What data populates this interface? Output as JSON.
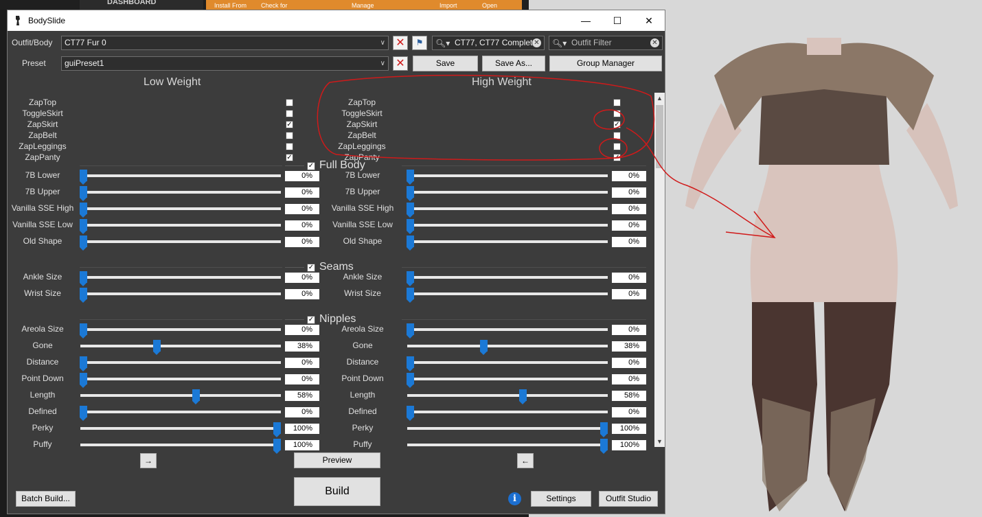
{
  "background_app": {
    "dashboard_label": "DASHBOARD",
    "toolbar_items": [
      "Install From",
      "Check for",
      "Manage",
      "Import",
      "Open"
    ]
  },
  "window": {
    "title": "BodySlide",
    "controls": {
      "minimize": "—",
      "maximize": "☐",
      "close": "✕"
    }
  },
  "top": {
    "outfit_label": "Outfit/Body",
    "outfit_value": "CT77 Fur 0",
    "preset_label": "Preset",
    "preset_value": "guiPreset1",
    "group_filter": "CT77, CT77 Complet",
    "outfit_filter_placeholder": "Outfit Filter",
    "save": "Save",
    "save_as": "Save As...",
    "group_manager": "Group Manager"
  },
  "columns": {
    "low": "Low Weight",
    "high": "High Weight"
  },
  "zaps": [
    {
      "label": "ZapTop",
      "low": false,
      "high": false
    },
    {
      "label": "ToggleSkirt",
      "low": false,
      "high": false
    },
    {
      "label": "ZapSkirt",
      "low": true,
      "high": true
    },
    {
      "label": "ZapBelt",
      "low": false,
      "high": false
    },
    {
      "label": "ZapLeggings",
      "low": false,
      "high": false
    },
    {
      "label": "ZapPanty",
      "low": true,
      "high": true
    }
  ],
  "sections": [
    {
      "title": "Full Body",
      "checked": true,
      "sliders": [
        {
          "label": "7B Lower",
          "low": 0,
          "high": 0
        },
        {
          "label": "7B Upper",
          "low": 0,
          "high": 0
        },
        {
          "label": "Vanilla SSE High",
          "low": 0,
          "high": 0
        },
        {
          "label": "Vanilla SSE Low",
          "low": 0,
          "high": 0
        },
        {
          "label": "Old Shape",
          "low": 0,
          "high": 0
        }
      ]
    },
    {
      "title": "Seams",
      "checked": true,
      "sliders": [
        {
          "label": "Ankle Size",
          "low": 0,
          "high": 0
        },
        {
          "label": "Wrist Size",
          "low": 0,
          "high": 0
        }
      ]
    },
    {
      "title": "Nipples",
      "checked": true,
      "sliders": [
        {
          "label": "Areola Size",
          "low": 0,
          "high": 0
        },
        {
          "label": "Gone",
          "low": 38,
          "high": 38
        },
        {
          "label": "Distance",
          "low": 0,
          "high": 0
        },
        {
          "label": "Point Down",
          "low": 0,
          "high": 0
        },
        {
          "label": "Length",
          "low": 58,
          "high": 58
        },
        {
          "label": "Defined",
          "low": 0,
          "high": 0
        },
        {
          "label": "Perky",
          "low": 100,
          "high": 100
        },
        {
          "label": "Puffy",
          "low": 100,
          "high": 100
        }
      ]
    }
  ],
  "bottom": {
    "copy_right": "→",
    "copy_left": "←",
    "preview": "Preview",
    "build": "Build",
    "batch_build": "Batch Build...",
    "info": "i",
    "settings": "Settings",
    "outfit_studio": "Outfit Studio"
  },
  "colors": {
    "panel": "#3c3c3c",
    "slider_thumb": "#1b79d6",
    "annotation": "#d01a1a",
    "viewport": "#d8d8d8"
  }
}
